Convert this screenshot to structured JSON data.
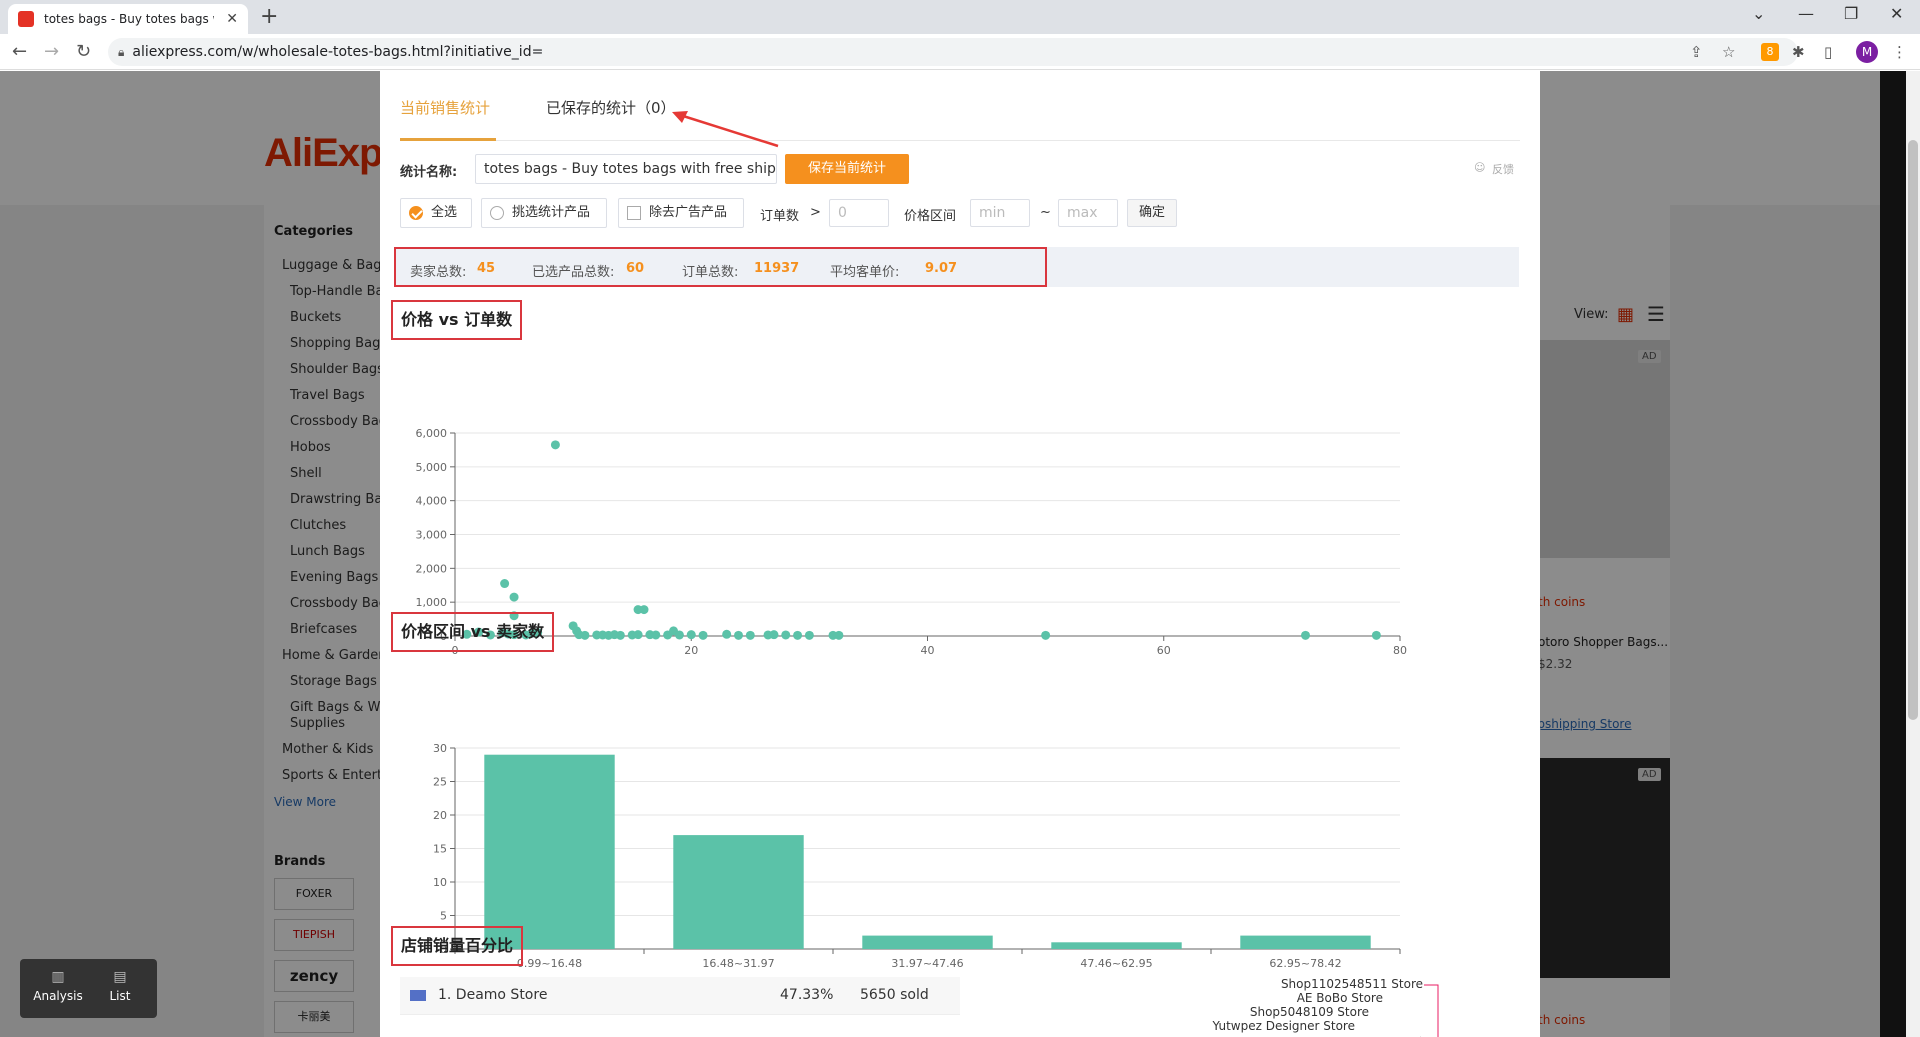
{
  "browser": {
    "tab_title": "totes bags - Buy totes bags wi",
    "tab_close": "✕",
    "new_tab": "+",
    "url": "aliexpress.com/w/wholesale-totes-bags.html?initiative_id=",
    "avatar_letter": "M",
    "ext_badge": "8"
  },
  "page": {
    "logo": "AliExpre",
    "categories_title": "Categories",
    "categories": [
      "Luggage & Bags",
      "Top-Handle Ba",
      "Buckets",
      "Shopping Bags",
      "Shoulder Bags",
      "Travel Bags",
      "Crossbody Bag",
      "Hobos",
      "Shell",
      "Drawstring Bag",
      "Clutches",
      "Lunch Bags",
      "Evening Bags",
      "Crossbody Bag",
      "Briefcases",
      "Home & Garden",
      "Storage Bags",
      "Gift Bags & Wra",
      "Supplies",
      "Mother & Kids",
      "Sports & Enterta"
    ],
    "view_more": "View More",
    "brands_title": "Brands",
    "brands": [
      "FOXER",
      "TIEPISH",
      "zency",
      "卡丽美"
    ],
    "view_label": "View:",
    "ad_label": "AD",
    "coins_1": "th coins",
    "product_title": "otoro Shopper Bags...",
    "product_price": "$2.32",
    "store_link": "opshipping Store",
    "coins_2": "th coins"
  },
  "modal": {
    "tab_current": "当前销售统计",
    "tab_saved": "已保存的统计（0）",
    "stat_name_label": "统计名称:",
    "stat_name_value": "totes bags - Buy totes bags with free shipp",
    "save_button": "保存当前统计",
    "feedback": "反馈",
    "filter_all": "全选",
    "filter_pick": "挑选统计产品",
    "filter_noads": "除去广告产品",
    "orders_label": "订单数",
    "orders_gt": ">",
    "orders_placeholder": "0",
    "price_range_label": "价格区间",
    "min_placeholder": "min",
    "range_sep": "~",
    "max_placeholder": "max",
    "confirm_button": "确定",
    "stats": {
      "sellers_label": "卖家总数:",
      "sellers_value": "45",
      "products_label": "已选产品总数:",
      "products_value": "60",
      "orders_label": "订单总数:",
      "orders_value": "11937",
      "avg_label": "平均客单价:",
      "avg_value": "9.07"
    },
    "section1_title": "价格 vs 订单数",
    "section2_title": "价格区间 vs 卖家数",
    "section3_title": "店铺销量百分比",
    "store_rows": [
      {
        "name": "1. Deamo Store",
        "pct": "47.33%",
        "sold": "5650 sold",
        "color": "#5470c6"
      }
    ],
    "pie_labels": [
      "Shop1102548511 Store",
      "AE BoBo Store",
      "Shop5048109 Store",
      "Yutwpez Designer Store"
    ]
  },
  "widget": {
    "analysis": "Analysis",
    "list": "List"
  },
  "colors": {
    "accent": "#f5901e",
    "chart": "#5bc2a8",
    "highlight": "#d9363e"
  },
  "chart_data": [
    {
      "type": "scatter",
      "title": "价格 vs 订单数",
      "xlim": [
        0,
        80
      ],
      "ylim": [
        0,
        6000
      ],
      "xticks": [
        0,
        20,
        40,
        60,
        80
      ],
      "yticks": [
        0,
        1000,
        2000,
        3000,
        4000,
        5000,
        6000
      ],
      "ytick_labels": [
        "0",
        "1,000",
        "2,000",
        "3,000",
        "4,000",
        "5,000",
        "6,000"
      ],
      "points": [
        [
          1,
          50
        ],
        [
          2,
          120
        ],
        [
          3,
          30
        ],
        [
          4,
          100
        ],
        [
          4.2,
          1550
        ],
        [
          4.5,
          60
        ],
        [
          5,
          40
        ],
        [
          5,
          1150
        ],
        [
          5,
          600
        ],
        [
          6,
          30
        ],
        [
          6.5,
          80
        ],
        [
          7,
          100
        ],
        [
          8.5,
          5650
        ],
        [
          10,
          300
        ],
        [
          10.3,
          150
        ],
        [
          10.5,
          40
        ],
        [
          11,
          20
        ],
        [
          12,
          30
        ],
        [
          12.5,
          30
        ],
        [
          13,
          20
        ],
        [
          13.5,
          40
        ],
        [
          14,
          20
        ],
        [
          15,
          30
        ],
        [
          15.5,
          40
        ],
        [
          15.5,
          780
        ],
        [
          16,
          780
        ],
        [
          16.5,
          40
        ],
        [
          17,
          30
        ],
        [
          18,
          30
        ],
        [
          18.5,
          150
        ],
        [
          19,
          30
        ],
        [
          20,
          40
        ],
        [
          21,
          20
        ],
        [
          23,
          50
        ],
        [
          24,
          20
        ],
        [
          25,
          20
        ],
        [
          26.5,
          30
        ],
        [
          27,
          40
        ],
        [
          28,
          30
        ],
        [
          29,
          20
        ],
        [
          30,
          20
        ],
        [
          32,
          20
        ],
        [
          32.5,
          20
        ],
        [
          50,
          20
        ],
        [
          72,
          20
        ],
        [
          78,
          20
        ]
      ]
    },
    {
      "type": "bar",
      "title": "价格区间 vs 卖家数",
      "categories": [
        "0.99~16.48",
        "16.48~31.97",
        "31.97~47.46",
        "47.46~62.95",
        "62.95~78.42"
      ],
      "values": [
        29,
        17,
        2,
        1,
        2
      ],
      "ylim": [
        0,
        30
      ],
      "yticks": [
        0,
        5,
        10,
        15,
        20,
        25,
        30
      ]
    }
  ]
}
